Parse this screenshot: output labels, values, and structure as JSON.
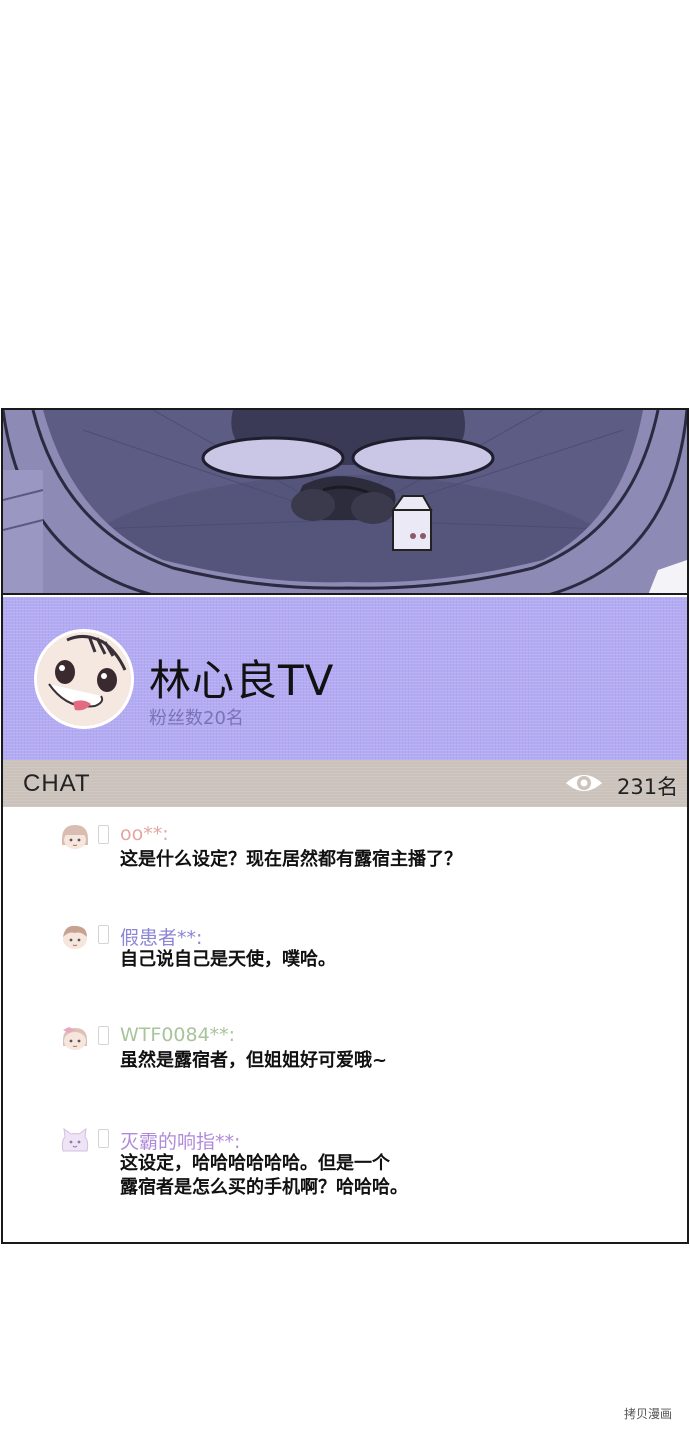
{
  "stream": {
    "channel_name": "林心良TV",
    "followers": "粉丝数20名",
    "avatar_icon": "cartoon-face-avatar"
  },
  "chat": {
    "title": "CHAT",
    "viewer_icon": "eye-icon",
    "viewer_count": "231名",
    "messages": [
      {
        "username": "oo**:",
        "username_color": "#e3a6a0",
        "avatar_icon": "girl-avatar",
        "lines": [
          "这是什么设定？现在居然都有露宿主播了？"
        ]
      },
      {
        "username": "假患者**:",
        "username_color": "#8b86d6",
        "avatar_icon": "boy-avatar",
        "lines": [
          "自己说自己是天使，噗哈。"
        ]
      },
      {
        "username": "WTF0084**:",
        "username_color": "#a8c49a",
        "avatar_icon": "girl-bow-avatar",
        "lines": [
          "虽然是露宿者，但姐姐好可爱哦~"
        ]
      },
      {
        "username": "灭霸的响指**:",
        "username_color": "#b08ad8",
        "avatar_icon": "cat-avatar",
        "lines": [
          "这设定，哈哈哈哈哈哈。但是一个",
          "露宿者是怎么买的手机啊？哈哈哈。"
        ]
      }
    ]
  },
  "watermark": "拷贝漫画"
}
